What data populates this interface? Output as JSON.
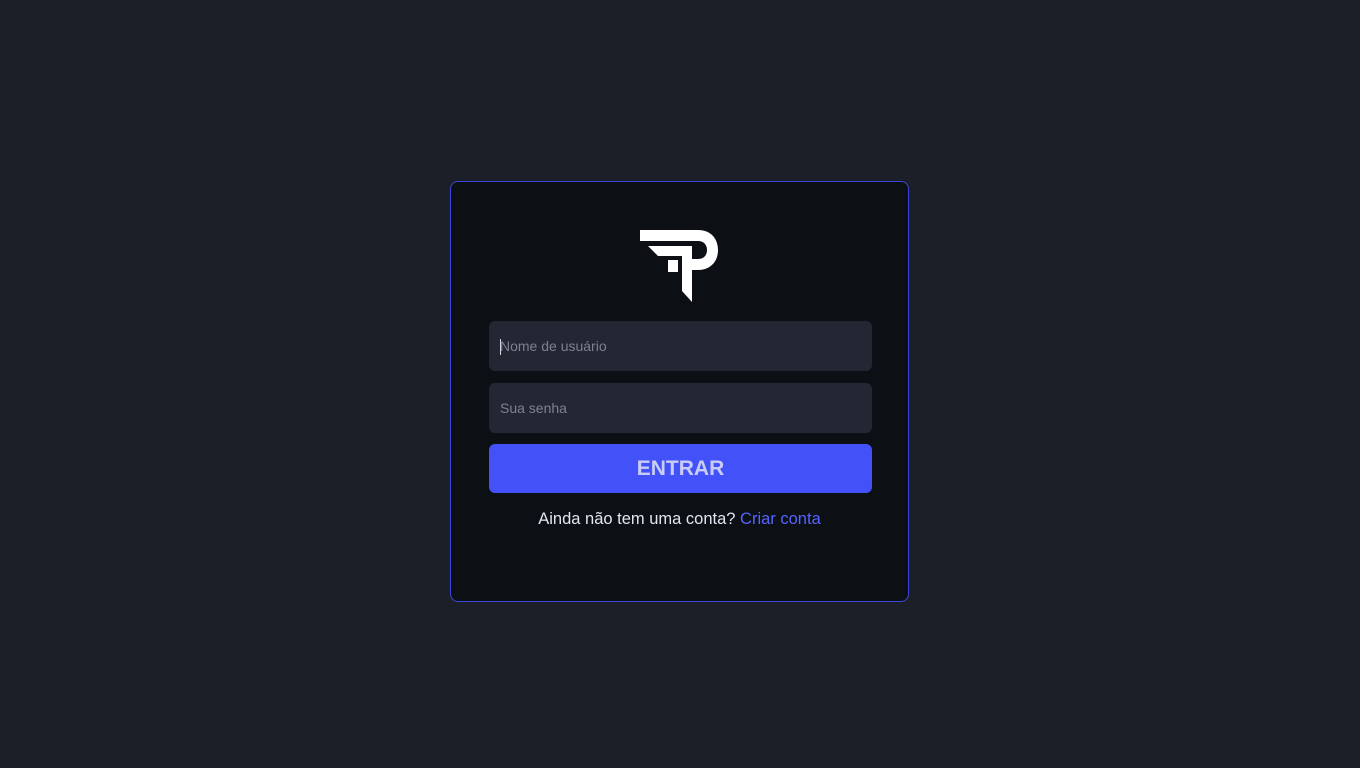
{
  "login": {
    "logo_icon": "tp-monogram-logo",
    "username": {
      "placeholder": "Nome de usuário",
      "value": ""
    },
    "password": {
      "placeholder": "Sua senha",
      "value": ""
    },
    "submit_label": "ENTRAR",
    "signup_prompt": "Ainda não tem uma conta?",
    "signup_link": "Criar conta"
  },
  "colors": {
    "background": "#1c1f27",
    "card": "#0c0f14",
    "card_border": "#3b46d9",
    "input": "#242733",
    "accent": "#4252f8",
    "link": "#5564ff"
  }
}
